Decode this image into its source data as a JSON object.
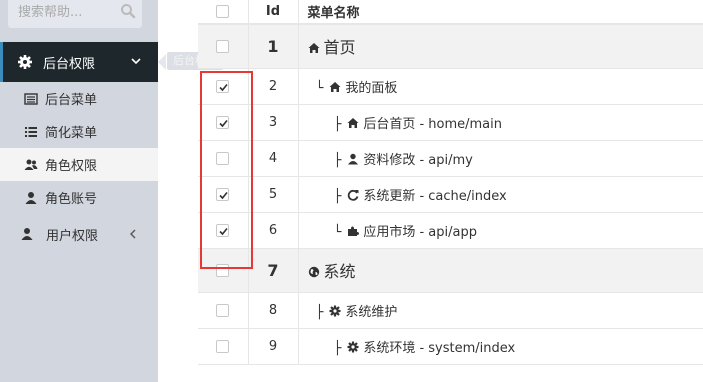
{
  "sidebar": {
    "search": {
      "placeholder": "搜索帮助..."
    },
    "parent": {
      "label": "后台权限"
    },
    "tooltip": "后台权限",
    "subitems": [
      {
        "label": "后台菜单",
        "icon": "list-alt-icon"
      },
      {
        "label": "简化菜单",
        "icon": "list-icon"
      },
      {
        "label": "角色权限",
        "icon": "users-icon"
      },
      {
        "label": "角色账号",
        "icon": "user-icon"
      }
    ],
    "user_menu": {
      "label": "用户权限",
      "icon": "user-icon"
    }
  },
  "table": {
    "headers": {
      "id": "Id",
      "name": "菜单名称"
    },
    "rows": [
      {
        "type": "group",
        "id": "1",
        "name": "首页",
        "icon": "home-icon",
        "checked": false
      },
      {
        "type": "row",
        "id": "2",
        "tree": "└",
        "name": "我的面板",
        "icon": "home-icon",
        "checked": true
      },
      {
        "type": "row",
        "id": "3",
        "tree": "├",
        "name": "后台首页 - home/main",
        "icon": "home-icon",
        "checked": true
      },
      {
        "type": "row",
        "id": "4",
        "tree": "├",
        "name": "资料修改 - api/my",
        "icon": "user-icon",
        "checked": false
      },
      {
        "type": "row",
        "id": "5",
        "tree": "├",
        "name": "系统更新 - cache/index",
        "icon": "refresh-icon",
        "checked": true
      },
      {
        "type": "row",
        "id": "6",
        "tree": "└",
        "name": "应用市场 - api/app",
        "icon": "puzzle-icon",
        "checked": true
      },
      {
        "type": "group",
        "id": "7",
        "name": "系统",
        "icon": "globe-icon",
        "checked": false
      },
      {
        "type": "row",
        "id": "8",
        "tree": "├",
        "name": "系统维护",
        "icon": "cog-icon",
        "checked": false
      },
      {
        "type": "row",
        "id": "9",
        "tree": "├",
        "name": "系统环境 - system/index",
        "icon": "cog-icon",
        "checked": false
      }
    ]
  },
  "colors": {
    "highlight": "#e53935",
    "sidebar_bg": "#d2d6de",
    "active_parent_bg": "#1e282c",
    "accent": "#3c8dbc"
  }
}
